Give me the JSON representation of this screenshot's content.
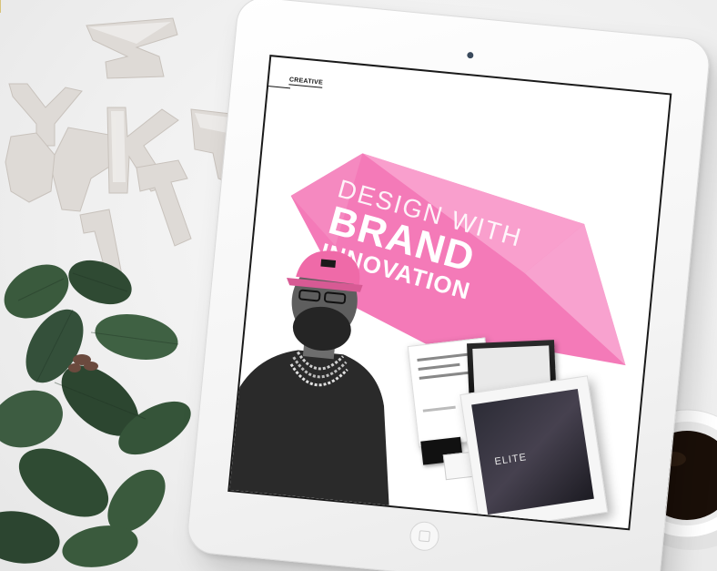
{
  "screen": {
    "section_label": "CREATIVE",
    "headline": {
      "line1": "DESIGN WITH",
      "line2": "BRAND",
      "line3": "INNOVATION"
    },
    "mockup_brand": "ELITE"
  },
  "colors": {
    "bubble_pink": "#f47ab8",
    "bubble_light": "#f9a6d0",
    "cap_pink": "#ef6aa8",
    "leaf_dark": "#2f4a33",
    "coffee": "#1a0f08"
  },
  "icons": [
    "camera-icon",
    "home-button-icon"
  ]
}
